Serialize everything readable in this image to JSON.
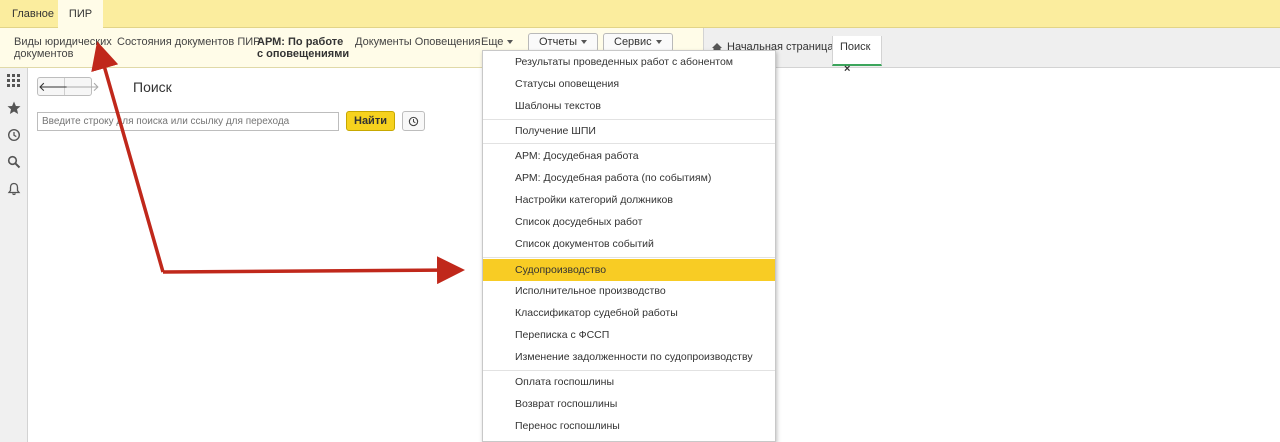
{
  "top_tabs": [
    {
      "label": "Главное"
    },
    {
      "label": "ПИР"
    }
  ],
  "section_panel": {
    "items": [
      {
        "line1": "Виды юридических",
        "line2": "документов"
      },
      {
        "line1": "Состояния документов ПИР",
        "line2": ""
      },
      {
        "line1": "АРМ: По работе",
        "line2": "с оповещениями"
      },
      {
        "line1": "Документы Оповещения",
        "line2": ""
      },
      {
        "line1": "Еще",
        "line2": ""
      }
    ],
    "reports_label": "Отчеты",
    "service_label": "Сервис"
  },
  "window_tabs": {
    "home_label": "Начальная страница",
    "search_label": "Поиск",
    "close_glyph": "×"
  },
  "form": {
    "back_glyph": "🡐",
    "forward_glyph": "🡒",
    "title": "Поиск",
    "search_placeholder": "Введите строку для поиска или ссылку для перехода",
    "find_button": "Найти"
  },
  "dropdown": {
    "items": [
      "Результаты проведенных работ с абонентом",
      "Статусы оповещения",
      "Шаблоны текстов",
      "Получение ШПИ",
      "АРМ: Досудебная работа",
      "АРМ: Досудебная работа (по событиям)",
      "Настройки категорий должников",
      "Список досудебных работ",
      "Список документов событий",
      "Судопроизводство",
      "Исполнительное производство",
      "Классификатор судебной работы",
      "Переписка с ФССП",
      "Изменение задолженности по судопроизводству",
      "Оплата госпошлины",
      "Возврат госпошлины",
      "Перенос госпошлины"
    ],
    "active_index": 9
  },
  "colors": {
    "top_bar": "#fbed9e",
    "panel": "#fffce8",
    "accent_yellow": "#f8cc24",
    "arrow_red": "#c0281b",
    "active_tab_underline": "#3ca55c"
  }
}
